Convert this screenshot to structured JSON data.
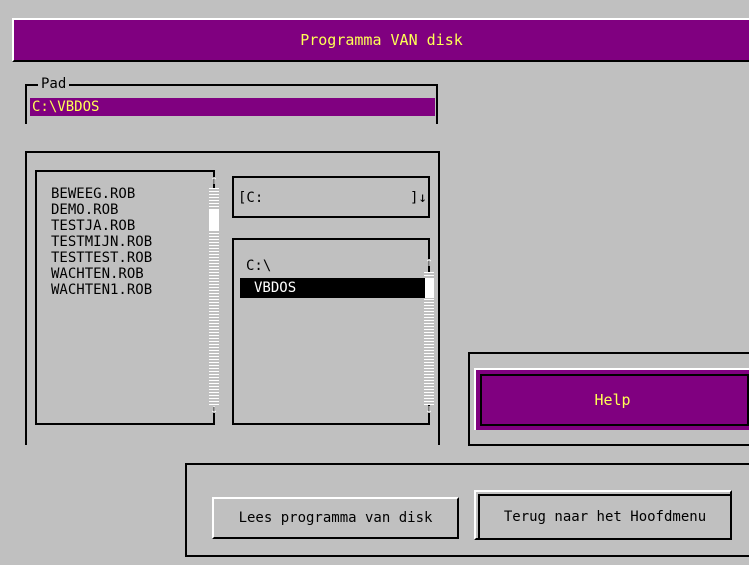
{
  "window": {
    "title": "Programma VAN disk"
  },
  "path": {
    "label": "Pad",
    "value": "C:\\VBDOS"
  },
  "files": {
    "items": [
      "BEWEEG.ROB",
      "DEMO.ROB",
      "TESTJA.ROB",
      "TESTMIJN.ROB",
      "TESTTEST.ROB",
      "WACHTEN.ROB",
      "WACHTEN1.ROB"
    ]
  },
  "drive": {
    "value": "[C:",
    "close": "]",
    "arrow": "↓"
  },
  "dirs": {
    "items": [
      "C:\\"
    ],
    "selected": "VBDOS"
  },
  "scroll": {
    "up": "↑",
    "down": "↓"
  },
  "buttons": {
    "help": "Help",
    "lees": "Lees programma van disk",
    "terug": "Terug naar het Hoofdmenu"
  },
  "colors": {
    "title_bg": "#800080",
    "title_fg": "#ffff55",
    "background": "#c0c0c0"
  }
}
